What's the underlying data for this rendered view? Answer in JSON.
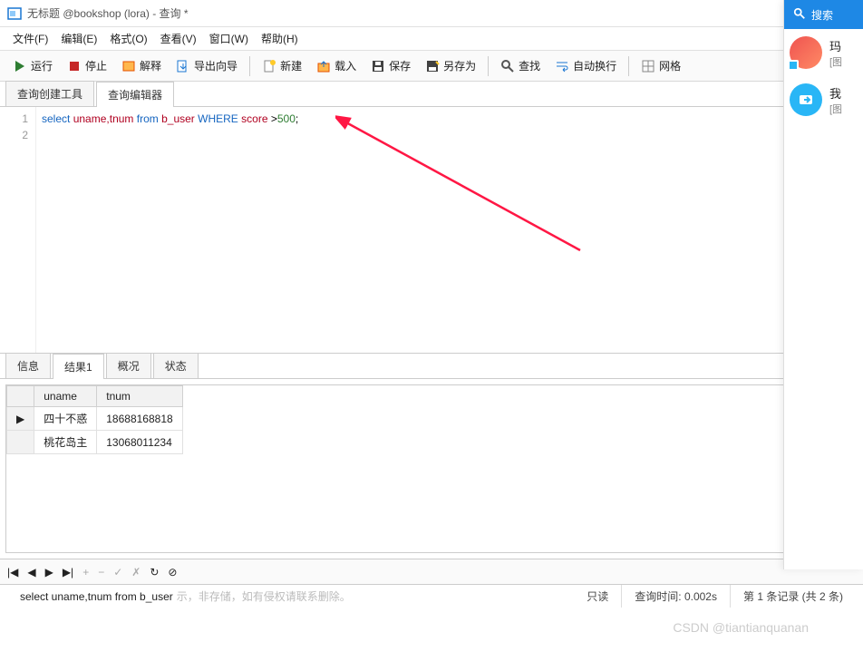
{
  "title": "无标题 @bookshop (lora) - 查询 *",
  "menu": [
    "文件(F)",
    "编辑(E)",
    "格式(O)",
    "查看(V)",
    "窗口(W)",
    "帮助(H)"
  ],
  "toolbar": {
    "run": "运行",
    "stop": "停止",
    "explain": "解释",
    "export": "导出向导",
    "new": "新建",
    "load": "载入",
    "save": "保存",
    "saveas": "另存为",
    "find": "查找",
    "wrap": "自动换行",
    "grid": "网格"
  },
  "upper_tabs": {
    "builder": "查询创建工具",
    "editor": "查询编辑器"
  },
  "sql": {
    "lines": [
      "1",
      "2"
    ],
    "tokens": {
      "select": "select",
      "cols": "uname,tnum",
      "from": "from",
      "tbl": "b_user",
      "where": "WHERE",
      "cond": "score",
      "op": ">",
      "val": "500",
      "semi": ";"
    }
  },
  "lower_tabs": {
    "info": "信息",
    "result": "结果1",
    "profile": "概况",
    "status": "状态"
  },
  "results": {
    "columns": [
      "uname",
      "tnum"
    ],
    "rows": [
      {
        "uname": "四十不惑",
        "tnum": "18688168818"
      },
      {
        "uname": "桃花岛主",
        "tnum": "13068011234"
      }
    ]
  },
  "nav": {
    "first": "|◀",
    "prev": "◀",
    "next": "▶",
    "last": "▶|",
    "add": "+",
    "del": "−",
    "ok": "✓",
    "cancel": "✗",
    "refresh": "↻",
    "stop2": "⊘"
  },
  "status": {
    "sql": "select uname,tnum from b_user",
    "note": "示，非存储，如有侵权请联系删除。",
    "readonly": "只读",
    "time_label": "查询时间:",
    "time_val": "0.002s",
    "records": "第 1 条记录 (共 2 条)"
  },
  "watermark": "CSDN @tiantianquanan",
  "side": {
    "search": "搜索",
    "contacts": [
      {
        "name": "玛",
        "sub": "[图"
      },
      {
        "name": "我",
        "sub": "[图"
      }
    ]
  }
}
